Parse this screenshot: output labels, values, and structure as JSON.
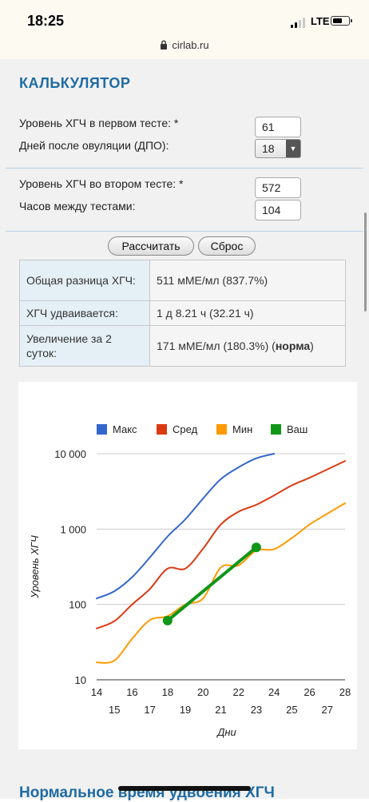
{
  "status": {
    "time": "18:25",
    "network": "LTE"
  },
  "browser": {
    "url": "cirlab.ru"
  },
  "calculator": {
    "title": "КАЛЬКУЛЯТОР",
    "test1_label": "Уровень ХГЧ в первом тесте: *",
    "test1_value": "61",
    "dpo_label": "Дней после овуляции (ДПО):",
    "dpo_value": "18",
    "test2_label": "Уровень ХГЧ во втором тесте: *",
    "test2_value": "572",
    "hours_label": "Часов между тестами:",
    "hours_value": "104",
    "calc_button": "Рассчитать",
    "reset_button": "Сброс"
  },
  "results": [
    {
      "label": "Общая разница ХГЧ:",
      "value": "511 мМЕ/мл (837.7%)"
    },
    {
      "label": "ХГЧ удваивается:",
      "value": "1 д 8.21 ч (32.21 ч)"
    },
    {
      "label": "Увеличение за 2 суток:",
      "value": "171 мМЕ/мл (180.3%) (",
      "value_bold": "норма",
      "value_end": ")"
    }
  ],
  "colors": {
    "accent": "#1f6ba3",
    "max": "#3366cc",
    "avg": "#dc3912",
    "min": "#ff9900",
    "yours": "#109618"
  },
  "chart_data": {
    "type": "line",
    "xlabel": "Дни",
    "ylabel": "Уровень ХГЧ",
    "yscale": "log",
    "ylim": [
      10,
      10000
    ],
    "xlim": [
      14,
      28
    ],
    "yticks": [
      10,
      100,
      1000,
      10000
    ],
    "ytick_labels": [
      "10",
      "100",
      "1 000",
      "10 000"
    ],
    "xticks": [
      14,
      15,
      16,
      17,
      18,
      19,
      20,
      21,
      22,
      23,
      24,
      25,
      26,
      27,
      28
    ],
    "legend_position": "top",
    "grid": "horizontal",
    "series": [
      {
        "name": "Макс",
        "color": "#3366cc",
        "x": [
          14,
          15,
          16,
          17,
          18,
          19,
          20,
          21,
          22,
          23,
          24
        ],
        "y": [
          120,
          150,
          230,
          420,
          800,
          1350,
          2550,
          4600,
          6600,
          8700,
          10000
        ]
      },
      {
        "name": "Сред",
        "color": "#dc3912",
        "x": [
          14,
          15,
          16,
          17,
          18,
          19,
          20,
          21,
          22,
          23,
          24,
          25,
          26,
          27,
          28
        ],
        "y": [
          48,
          60,
          100,
          160,
          300,
          300,
          550,
          1150,
          1700,
          2100,
          2800,
          3800,
          4800,
          6200,
          8000
        ]
      },
      {
        "name": "Мин",
        "color": "#ff9900",
        "x": [
          14,
          15,
          16,
          17,
          18,
          19,
          20,
          21,
          22,
          23,
          24,
          25,
          26,
          27,
          28
        ],
        "y": [
          17,
          18,
          35,
          62,
          70,
          100,
          120,
          310,
          330,
          520,
          540,
          760,
          1150,
          1600,
          2200
        ]
      },
      {
        "name": "Ваш",
        "color": "#109618",
        "x": [
          18,
          23
        ],
        "y": [
          61,
          572
        ]
      }
    ]
  },
  "next_section_heading": "Нормальное время удвоения ХГЧ"
}
